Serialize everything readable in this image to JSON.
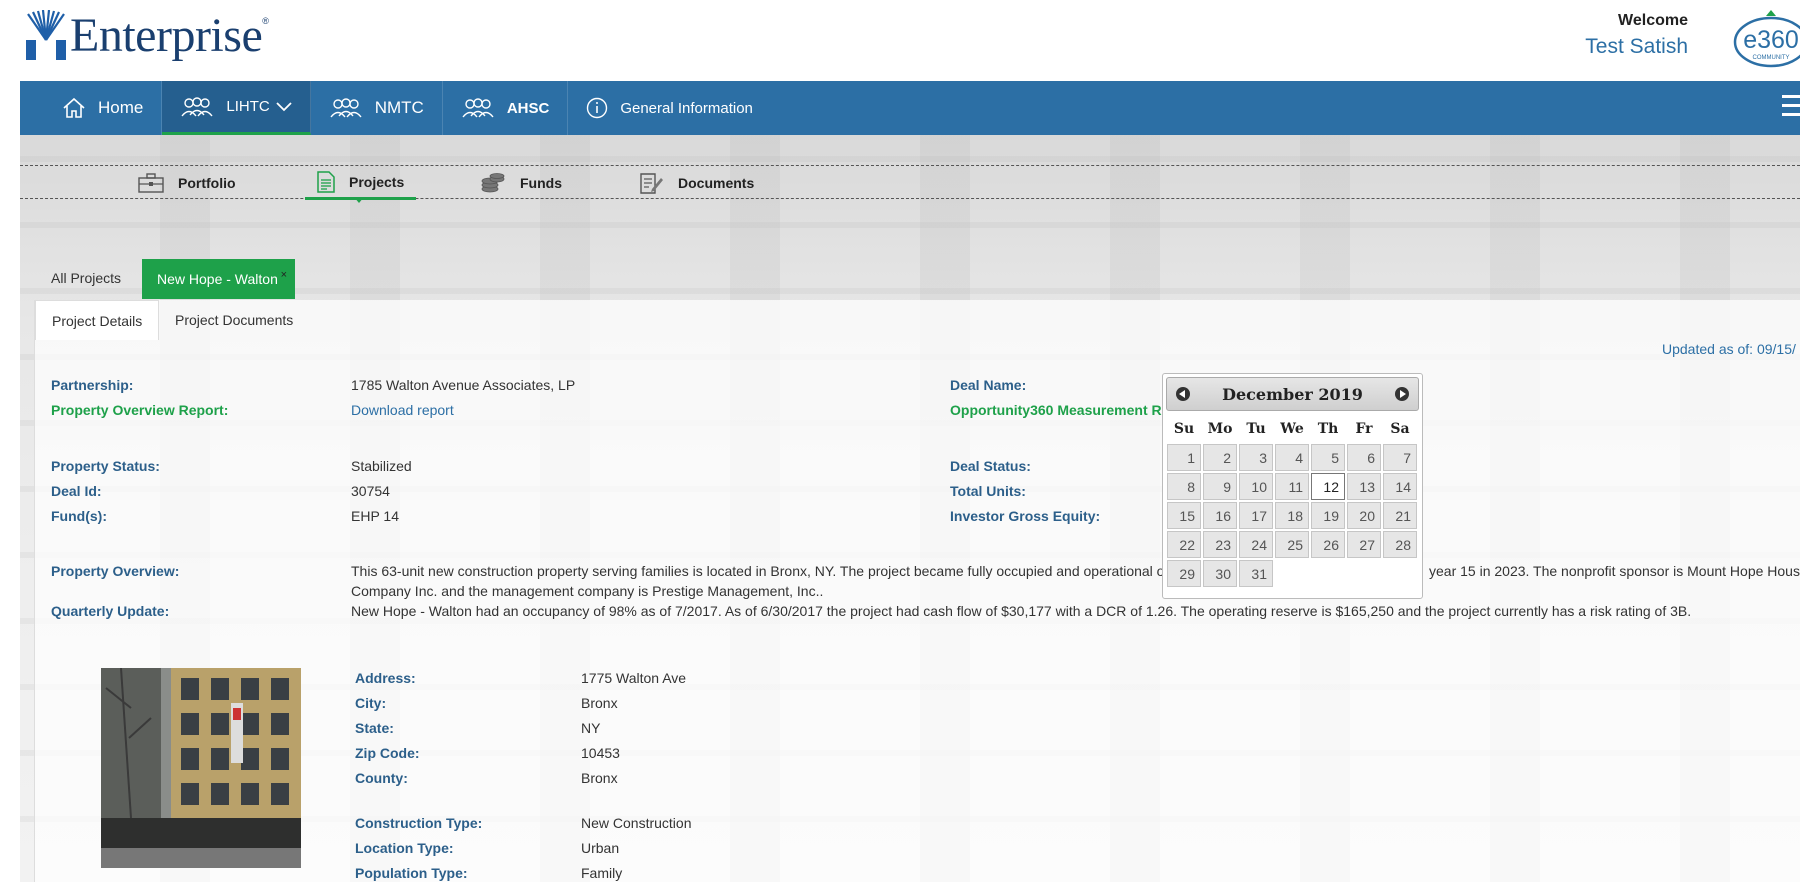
{
  "header": {
    "logo_text": "Enterprise",
    "logo_reg": "®",
    "welcome_title": "Welcome",
    "user_name": "Test Satish",
    "badge_text": "e360",
    "badge_sub": "COMMUNITY"
  },
  "nav": {
    "home": "Home",
    "lihtc": "LIHTC",
    "nmtc": "NMTC",
    "ahsc": "AHSC",
    "general": "General Information"
  },
  "subnav": {
    "portfolio": "Portfolio",
    "projects": "Projects",
    "funds": "Funds",
    "documents": "Documents"
  },
  "project_tabs": {
    "all": "All Projects",
    "current": "New Hope - Walton",
    "close": "×"
  },
  "detail_tabs": {
    "details": "Project Details",
    "documents": "Project Documents"
  },
  "updated": "Updated as of: 09/15/",
  "fields": {
    "partnership_label": "Partnership:",
    "partnership_value": "1785 Walton Avenue Associates, LP",
    "overview_report_label": "Property Overview Report:",
    "overview_report_value": "Download report",
    "deal_name_label": "Deal Name:",
    "opportunity_label": "Opportunity360 Measurement Re",
    "property_status_label": "Property Status:",
    "property_status_value": "Stabilized",
    "deal_id_label": "Deal Id:",
    "deal_id_value": "30754",
    "funds_label": "Fund(s):",
    "funds_value": "EHP 14",
    "deal_status_label": "Deal Status:",
    "total_units_label": "Total Units:",
    "investor_label": "Investor Gross Equity:",
    "property_overview_label": "Property Overview:",
    "property_overview_line1": "This 63-unit new construction property serving families is located in Bronx, NY. The project became fully occupied and operational o",
    "property_overview_line1b": "year 15 in 2023. The nonprofit sponsor is Mount Hope Housing",
    "property_overview_line2": "Company Inc. and the management company is Prestige Management, Inc..",
    "quarterly_label": "Quarterly Update:",
    "quarterly_value": "New Hope - Walton had an occupancy of 98% as of 7/2017. As of 6/30/2017 the project had cash flow of $30,177 with a DCR of 1.26. The operating reserve is $165,250 and the project currently has a risk rating of 3B."
  },
  "address": {
    "address_label": "Address:",
    "address_value": "1775 Walton Ave",
    "city_label": "City:",
    "city_value": "Bronx",
    "state_label": "State:",
    "state_value": "NY",
    "zip_label": "Zip Code:",
    "zip_value": "10453",
    "county_label": "County:",
    "county_value": "Bronx",
    "construction_label": "Construction Type:",
    "construction_value": "New Construction",
    "location_label": "Location Type:",
    "location_value": "Urban",
    "population_label": "Population Type:",
    "population_value": "Family"
  },
  "calendar": {
    "title": "December 2019",
    "weekdays": [
      "Su",
      "Mo",
      "Tu",
      "We",
      "Th",
      "Fr",
      "Sa"
    ],
    "days": [
      "1",
      "2",
      "3",
      "4",
      "5",
      "6",
      "7",
      "8",
      "9",
      "10",
      "11",
      "12",
      "13",
      "14",
      "15",
      "16",
      "17",
      "18",
      "19",
      "20",
      "21",
      "22",
      "23",
      "24",
      "25",
      "26",
      "27",
      "28",
      "29",
      "30",
      "31"
    ],
    "today": "12"
  },
  "colors": {
    "brand_blue": "#2c6fa5",
    "accent_green": "#1ea14a",
    "label_blue": "#2c5f8a"
  }
}
